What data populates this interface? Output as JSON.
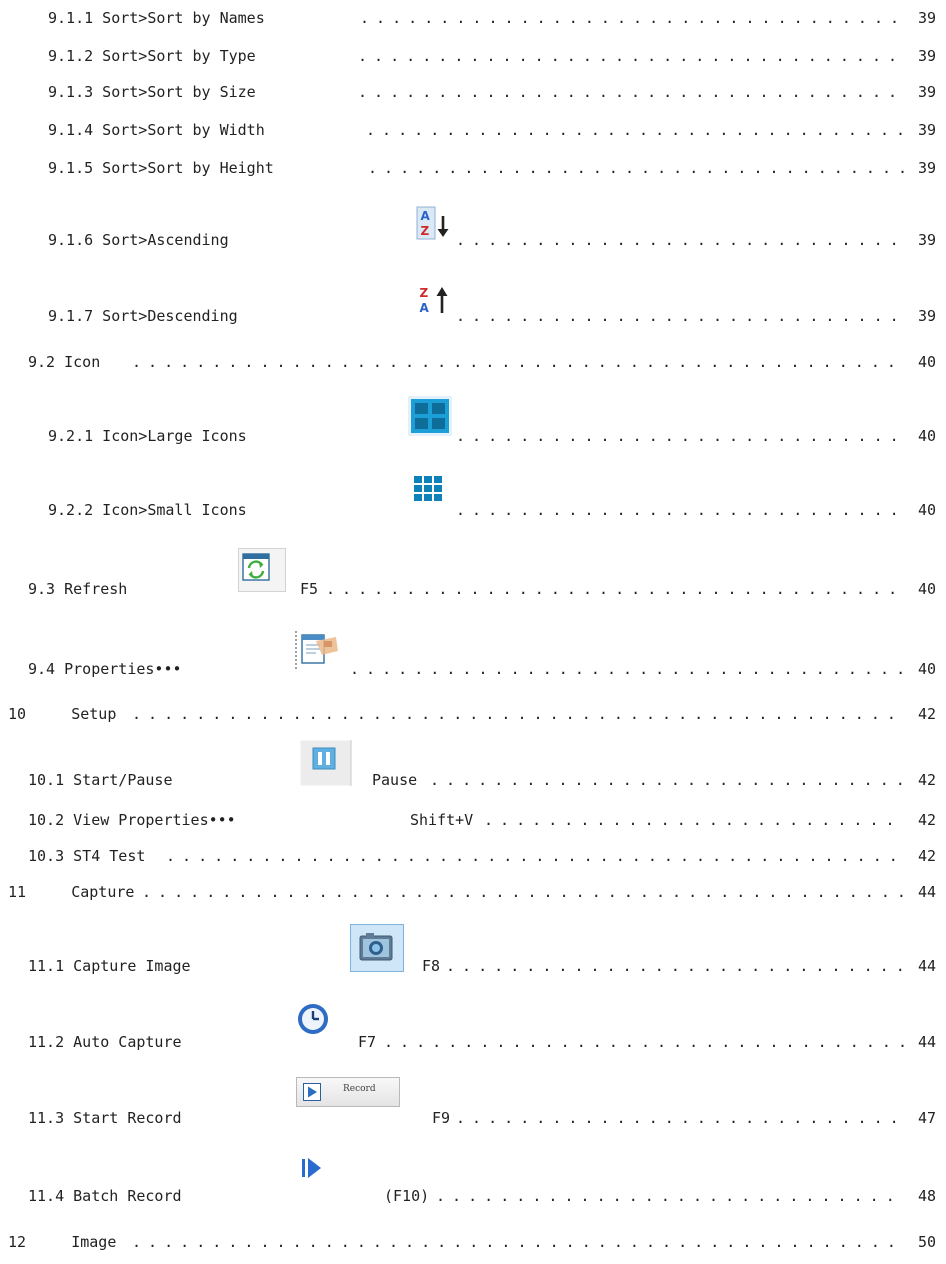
{
  "toc": [
    {
      "label": "9.1.1 Sort>Sort by Names",
      "page": "39"
    },
    {
      "label": "9.1.2 Sort>Sort by Type",
      "page": "39"
    },
    {
      "label": "9.1.3 Sort>Sort by Size",
      "page": "39"
    },
    {
      "label": "9.1.4 Sort>Sort by Width",
      "page": "39"
    },
    {
      "label": "9.1.5 Sort>Sort by Height",
      "page": "39"
    },
    {
      "label": "9.1.6 Sort>Ascending",
      "page": "39",
      "icon": "sort-ascending-icon"
    },
    {
      "label": "9.1.7 Sort>Descending",
      "page": "39",
      "icon": "sort-descending-icon"
    },
    {
      "label": "9.2 Icon",
      "page": "40"
    },
    {
      "label": "9.2.1 Icon>Large Icons",
      "page": "40",
      "icon": "large-icons-icon"
    },
    {
      "label": "9.2.2 Icon>Small Icons",
      "page": "40",
      "icon": "small-icons-icon"
    },
    {
      "label": "9.3 Refresh",
      "page": "40",
      "icon": "refresh-icon",
      "shortcut": "F5"
    },
    {
      "label": "9.4 Properties•••",
      "page": "40",
      "icon": "properties-icon"
    },
    {
      "label": "10     Setup",
      "page": "42"
    },
    {
      "label": "10.1 Start/Pause",
      "page": "42",
      "icon": "pause-icon",
      "shortcut": "Pause"
    },
    {
      "label": "10.2 View Properties•••",
      "page": "42",
      "shortcut": "Shift+V"
    },
    {
      "label": "10.3 ST4 Test",
      "page": "42"
    },
    {
      "label": "11     Capture",
      "page": "44"
    },
    {
      "label": "11.1 Capture Image",
      "page": "44",
      "icon": "camera-icon",
      "shortcut": "F8"
    },
    {
      "label": "11.2 Auto Capture",
      "page": "44",
      "icon": "clock-icon",
      "shortcut": "F7"
    },
    {
      "label": "11.3 Start Record",
      "page": "47",
      "icon": "record-button-icon",
      "shortcut": "F9",
      "button_text": "Record"
    },
    {
      "label": "11.4 Batch Record",
      "page": "48",
      "icon": "batch-record-icon",
      "shortcut": "(F10)"
    },
    {
      "label": "12     Image",
      "page": "50"
    }
  ]
}
